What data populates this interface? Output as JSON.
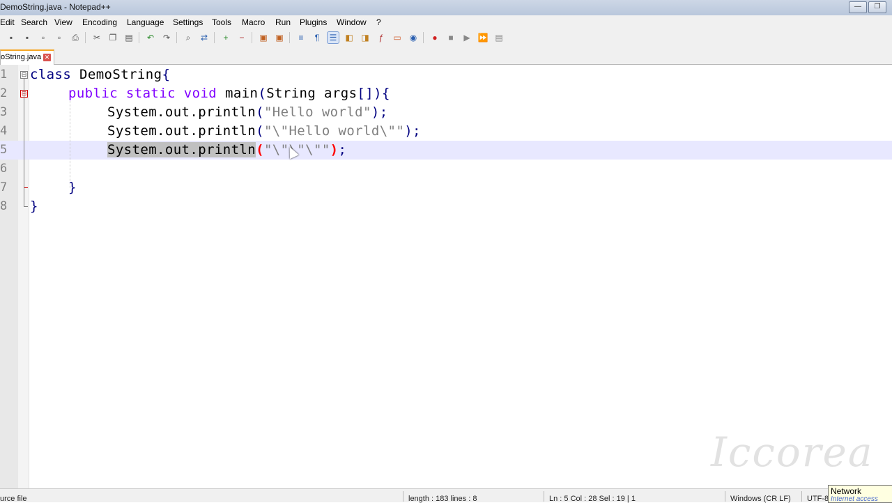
{
  "window": {
    "title": "DemoString.java - Notepad++",
    "minimize_symbol": "—",
    "restore_symbol": "❐"
  },
  "menu": {
    "items": [
      "Edit",
      "Search",
      "View",
      "Encoding",
      "Language",
      "Settings",
      "Tools",
      "Macro",
      "Run",
      "Plugins",
      "Window",
      "?"
    ]
  },
  "toolbar": {
    "icons": [
      "new-file-icon",
      "open-file-icon",
      "save-icon",
      "save-all-icon",
      "close-icon",
      "close-all-icon",
      "print-icon",
      "cut-icon",
      "copy-icon",
      "paste-icon",
      "undo-icon",
      "redo-icon",
      "find-icon",
      "replace-icon",
      "zoom-in-icon",
      "zoom-out-icon",
      "sync-vertical-icon",
      "sync-horizontal-icon",
      "word-wrap-icon",
      "show-all-chars-icon",
      "indent-guide-icon",
      "user-lang-icon",
      "doc-map-icon",
      "function-list-icon",
      "folder-workspace-icon",
      "monitoring-icon",
      "record-macro-icon",
      "stop-macro-icon",
      "play-macro-icon",
      "run-macro-multiple-icon",
      "save-macro-icon"
    ]
  },
  "tab": {
    "label": "oString.java",
    "close_symbol": "✕"
  },
  "editor": {
    "line_numbers": [
      "1",
      "2",
      "3",
      "4",
      "5",
      "6",
      "7",
      "8"
    ],
    "fold_open_symbol": "⊟",
    "fold_close_symbol": "⊟",
    "code": {
      "l1_kw": "class",
      "l1_rest": " DemoString",
      "l1_brace": "{",
      "l2_public": "public",
      "l2_static": "static",
      "l2_void": "void",
      "l2_main": " main",
      "l2_paren_open": "(",
      "l2_args": "String args",
      "l2_brackets": "[]",
      "l2_paren_close": ")",
      "l2_brace": "{",
      "l3_call": "System.out.println",
      "l3_open": "(",
      "l3_str": "\"Hello world\"",
      "l3_close": ");",
      "l4_call": "System.out.println",
      "l4_open": "(",
      "l4_str": "\"\\\"Hello world\\\"\"",
      "l4_close": ");",
      "l5_call_selected": "System.out.println",
      "l5_open": "(",
      "l5_str": "\"\\\"\\\"\\\"\"",
      "l5_close": ")",
      "l5_semi": ";",
      "l7_brace": "}",
      "l8_brace": "}"
    }
  },
  "statusbar": {
    "file_type": "urce file",
    "length_lines": "length : 183    lines : 8",
    "position": "Ln : 5    Col : 28    Sel : 19 | 1",
    "eol": "Windows (CR LF)",
    "encoding": "UTF-8"
  },
  "tooltip": {
    "title": "Network",
    "subtitle": "Internet access"
  },
  "watermark": {
    "text": "Iccorea"
  }
}
